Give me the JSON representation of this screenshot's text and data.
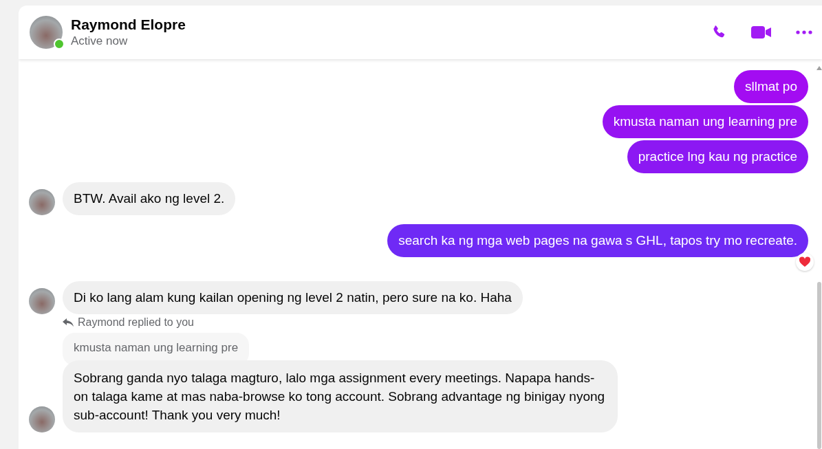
{
  "header": {
    "name": "Raymond Elopre",
    "status": "Active now",
    "online": true
  },
  "messages": [
    {
      "kind": "sent",
      "text": "sllmat po",
      "color": "#a30cf2"
    },
    {
      "kind": "sent",
      "text": "kmusta naman ung learning pre",
      "color": "#9612f2"
    },
    {
      "kind": "sent",
      "text": "practice lng kau ng practice",
      "color": "#8c18f3"
    },
    {
      "kind": "received",
      "text": "BTW. Avail ako ng level 2."
    },
    {
      "kind": "sent",
      "text": "search ka ng mga web pages na gawa s GHL, tapos try mo recreate.",
      "color": "#6f2af5",
      "reacted": true
    },
    {
      "kind": "received",
      "text": "Di ko lang alam kung kailan opening ng level 2 natin, pero sure na ko. Haha"
    },
    {
      "kind": "reply",
      "label": "Raymond replied to you",
      "quote": "kmusta naman ung learning pre",
      "text": "Sobrang ganda nyo talaga magturo, lalo mga assignment every meetings. Napapa hands-on talaga kame at mas naba-browse ko tong account. Sobrang advantage ng binigay nyong sub-account! Thank you very much!"
    }
  ]
}
